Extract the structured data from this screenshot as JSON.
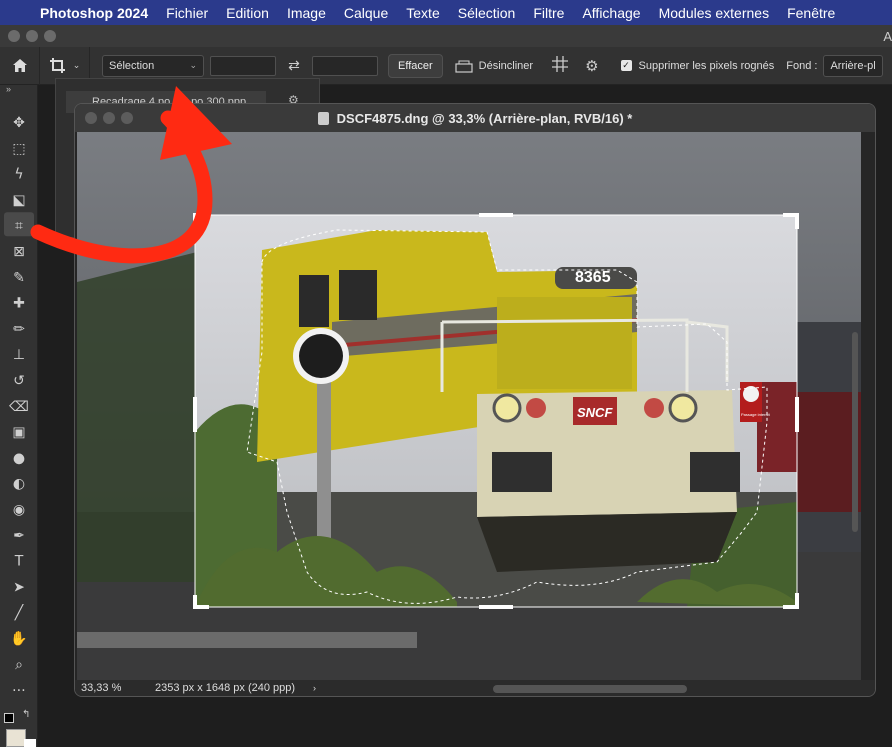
{
  "menubar": {
    "app_name": "Photoshop 2024",
    "items": [
      "Fichier",
      "Edition",
      "Image",
      "Calque",
      "Texte",
      "Sélection",
      "Filtre",
      "Affichage",
      "Modules externes",
      "Fenêtre"
    ],
    "edge_letter": "A"
  },
  "options": {
    "ratio_value": "Sélection",
    "clear_label": "Effacer",
    "straighten_label": "Désincliner",
    "delete_pixels_label": "Supprimer les pixels rognés",
    "delete_pixels_checked": true,
    "fond_label": "Fond :",
    "fond_value": "Arrière-pl"
  },
  "presets_panel": {
    "item_label": "Recadrage 4 po x 5 po 300 ppp"
  },
  "document": {
    "title": "DSCF4875.dng @ 33,3% (Arrière-plan, RVB/16) *",
    "zoom": "33,33 %",
    "doc_info": "2353 px x 1648 px (240 ppp)"
  },
  "photo": {
    "loco_number": "8365",
    "logo_text": "SNCF",
    "sign_text": "Passage interdit"
  },
  "tools": [
    "move-tool",
    "marquee-tool",
    "lasso-tool",
    "object-selection-tool",
    "crop-tool",
    "frame-tool",
    "eyedropper-tool",
    "healing-brush-tool",
    "brush-tool",
    "stamp-tool",
    "history-brush-tool",
    "eraser-tool",
    "gradient-tool",
    "blur-tool",
    "dodge-tool",
    "sponge-tool",
    "pen-tool",
    "type-tool",
    "path-selection-tool",
    "line-tool",
    "hand-tool",
    "zoom-tool",
    "more-tools"
  ],
  "colors": {
    "menubar_bg": "#2b3a8c",
    "annotation_arrow": "#ff2a12",
    "locomotive_yellow": "#c9b81c"
  }
}
